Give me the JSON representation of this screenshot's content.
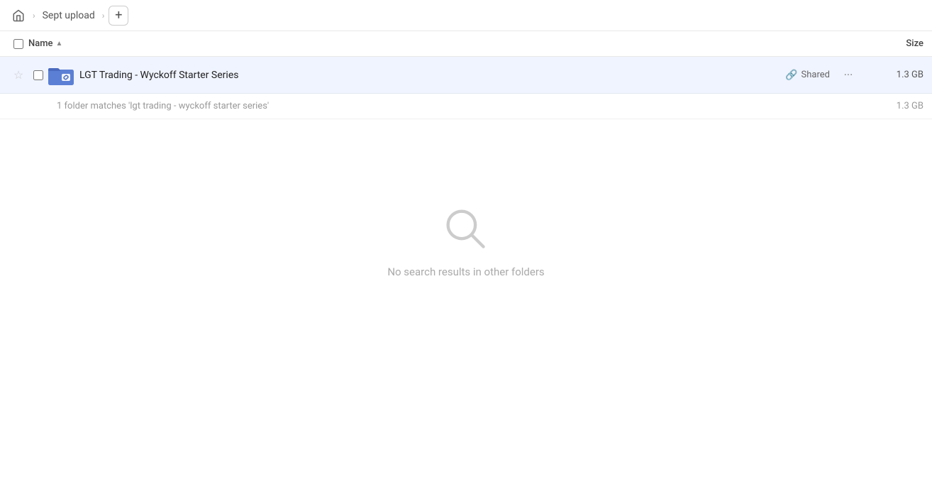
{
  "toolbar": {
    "home_icon": "🏠",
    "breadcrumb": [
      {
        "label": "Sept upload"
      }
    ],
    "add_button_label": "+"
  },
  "columns": {
    "name_label": "Name",
    "size_label": "Size"
  },
  "file_row": {
    "name": "LGT Trading - Wyckoff Starter Series",
    "shared_label": "Shared",
    "size": "1.3 GB",
    "more_icon": "···"
  },
  "match_row": {
    "text": "1 folder matches 'lgt trading - wyckoff starter series'",
    "size": "1.3 GB"
  },
  "empty_state": {
    "message": "No search results in other folders"
  }
}
